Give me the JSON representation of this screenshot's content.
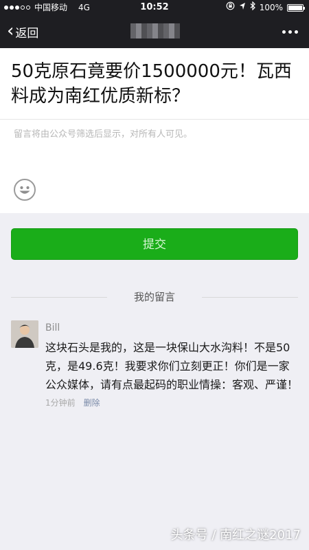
{
  "status_bar": {
    "carrier": "中国移动",
    "network": "4G",
    "time": "10:52",
    "battery": "100%",
    "icons": [
      "lock-rotation-icon",
      "location-icon",
      "bluetooth-icon",
      "battery-icon"
    ]
  },
  "nav": {
    "back_label": "返回",
    "more_icon": "more-icon"
  },
  "article": {
    "title": "50克原石竟要价1500000元！瓦西料成为南红优质新标？"
  },
  "comment_form": {
    "placeholder": "留言将由公众号筛选后显示，对所有人可见。",
    "value": "",
    "emoji_icon": "smiley-icon"
  },
  "submit_label": "提交",
  "my_comments": {
    "heading": "我的留言",
    "items": [
      {
        "name": "Bill",
        "text": "这块石头是我的，这是一块保山大水沟料！不是50克，是49.6克！我要求你们立刻更正！你们是一家公众媒体，请有点最起码的职业情操：客观、严谨！",
        "time": "1分钟前",
        "delete_label": "删除"
      }
    ]
  },
  "watermark": "头条号 / 南红之谜2017",
  "colors": {
    "nav_bg": "#1e1e22",
    "accent_green": "#1aad19",
    "page_bg": "#efeff4"
  }
}
